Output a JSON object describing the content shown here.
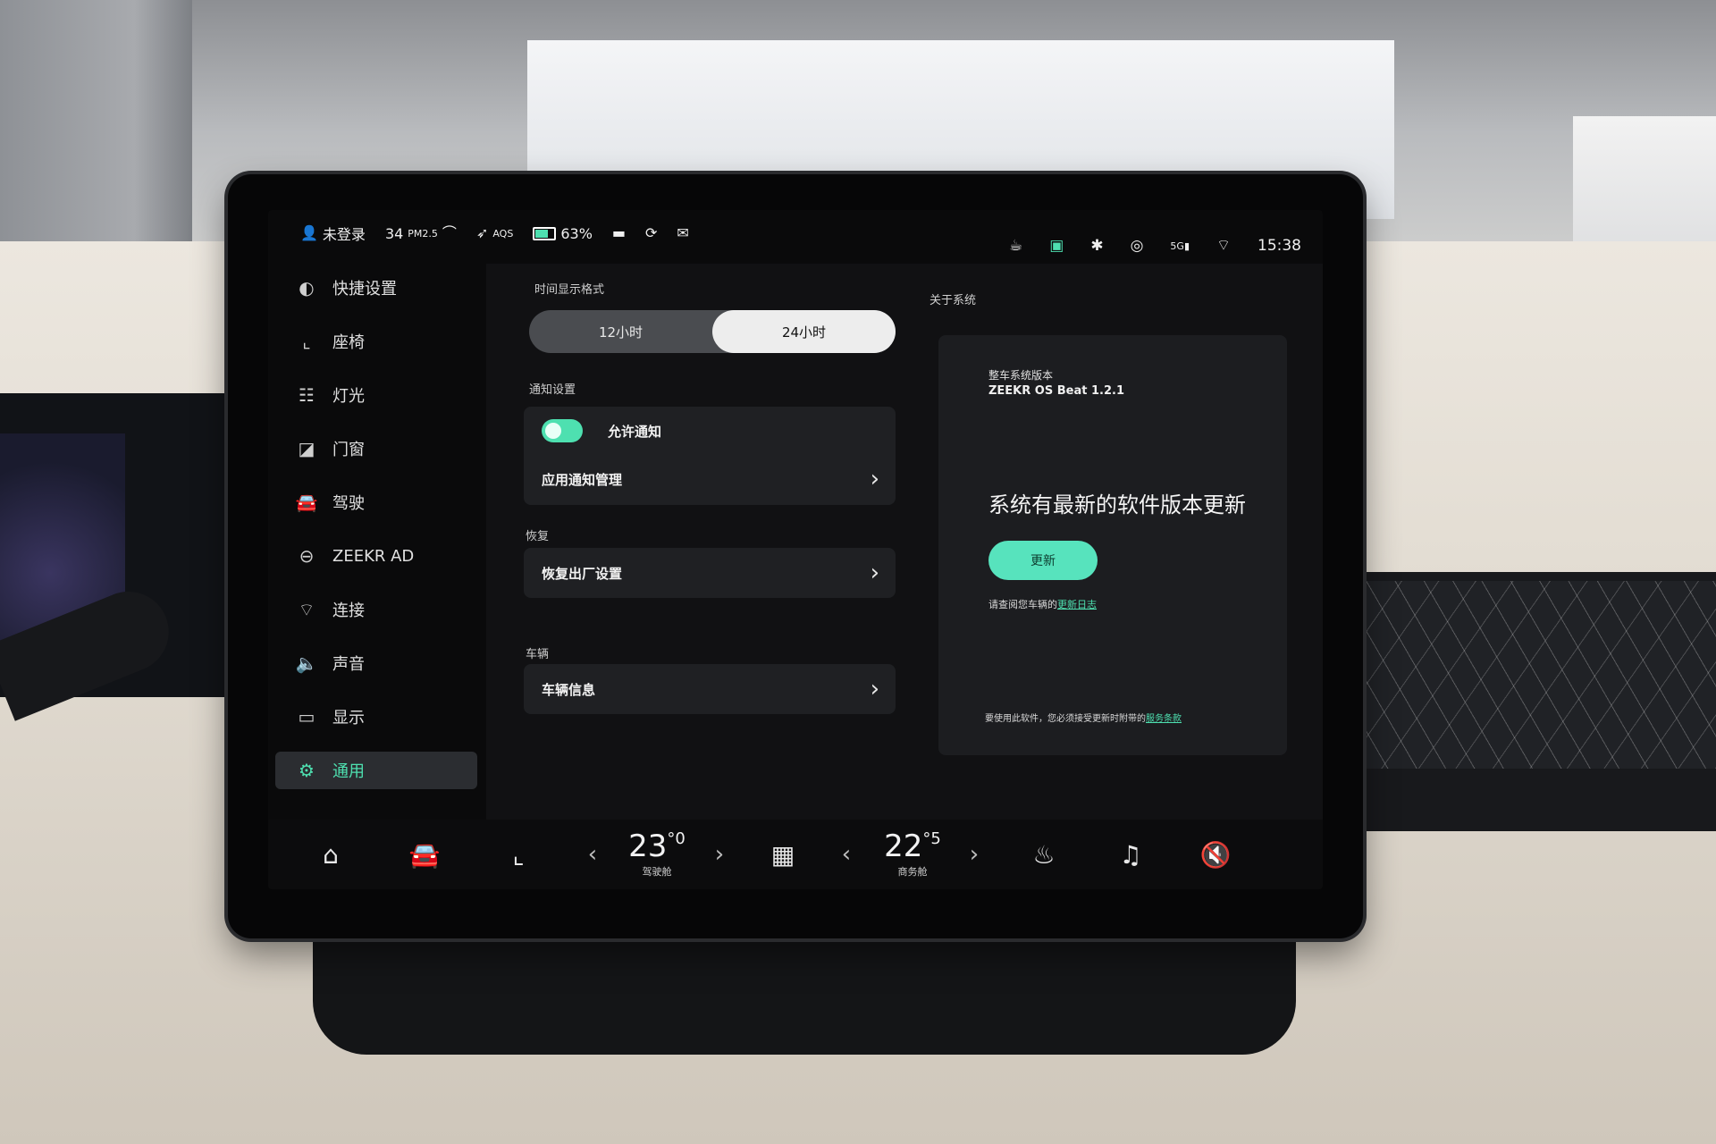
{
  "status_bar": {
    "user": "未登录",
    "pm25_value": "34",
    "pm25_label": "PM2.5",
    "aqs_label": "AQS",
    "battery": "63%",
    "time": "15:38",
    "signal_label": "5G"
  },
  "sidebar": {
    "items": [
      {
        "label": "快捷设置",
        "icon": "toggle-icon"
      },
      {
        "label": "座椅",
        "icon": "seat-icon"
      },
      {
        "label": "灯光",
        "icon": "light-icon"
      },
      {
        "label": "门窗",
        "icon": "door-icon"
      },
      {
        "label": "驾驶",
        "icon": "car-icon"
      },
      {
        "label": "ZEEKR AD",
        "icon": "steering-wheel-icon"
      },
      {
        "label": "连接",
        "icon": "wifi-icon"
      },
      {
        "label": "声音",
        "icon": "speaker-icon"
      },
      {
        "label": "显示",
        "icon": "monitor-icon"
      },
      {
        "label": "通用",
        "icon": "gear-icon",
        "active": true
      }
    ]
  },
  "time_format": {
    "label": "时间显示格式",
    "option_12": "12小时",
    "option_24": "24小时",
    "selected": "24小时"
  },
  "notifications": {
    "label": "通知设置",
    "allow_label": "允许通知",
    "allow_on": true,
    "manage_label": "应用通知管理"
  },
  "restore": {
    "label": "恢复",
    "factory_label": "恢复出厂设置"
  },
  "vehicle": {
    "label": "车辆",
    "info_label": "车辆信息"
  },
  "about": {
    "label": "关于系统",
    "version_label": "整车系统版本",
    "version_value": "ZEEKR OS Beat 1.2.1",
    "update_title": "系统有最新的软件版本更新",
    "update_button": "更新",
    "note_prefix": "请查阅您车辆的",
    "note_link": "更新日志",
    "terms_prefix": "要使用此软件，您必须接受更新时附带的",
    "terms_link": "服务条款"
  },
  "dock": {
    "driver_temp_int": "23",
    "driver_temp_dec": "0",
    "driver_label": "驾驶舱",
    "rear_temp_int": "22",
    "rear_temp_dec": "5",
    "rear_label": "商务舱"
  },
  "colors": {
    "accent": "#4ee0b0",
    "screen_bg": "#0a0a0b",
    "card_bg": "#1f2023"
  }
}
